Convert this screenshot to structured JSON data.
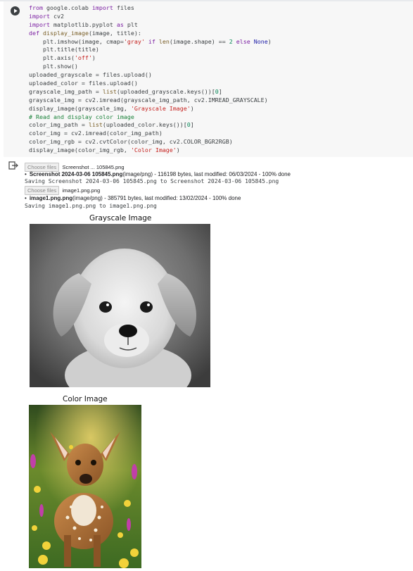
{
  "code_lines": [
    [
      {
        "t": "from",
        "c": "kw"
      },
      {
        "t": " google.colab "
      },
      {
        "t": "import",
        "c": "kw"
      },
      {
        "t": " files"
      }
    ],
    [
      {
        "t": "import",
        "c": "kw"
      },
      {
        "t": " cv2"
      }
    ],
    [
      {
        "t": "import",
        "c": "kw"
      },
      {
        "t": " matplotlib.pyplot "
      },
      {
        "t": "as",
        "c": "kw"
      },
      {
        "t": " plt"
      }
    ],
    [
      {
        "t": "def",
        "c": "kw"
      },
      {
        "t": " "
      },
      {
        "t": "display_image",
        "c": "bi"
      },
      {
        "t": "(image, title):"
      }
    ],
    [
      {
        "t": "    plt.imshow(image, cmap="
      },
      {
        "t": "'gray'",
        "c": "str"
      },
      {
        "t": " "
      },
      {
        "t": "if",
        "c": "kw"
      },
      {
        "t": " "
      },
      {
        "t": "len",
        "c": "bi"
      },
      {
        "t": "(image.shape) == "
      },
      {
        "t": "2",
        "c": "num"
      },
      {
        "t": " "
      },
      {
        "t": "else",
        "c": "kw"
      },
      {
        "t": " "
      },
      {
        "t": "None",
        "c": "fn"
      },
      {
        "t": ")"
      }
    ],
    [
      {
        "t": "    plt.title(title)"
      }
    ],
    [
      {
        "t": "    plt.axis("
      },
      {
        "t": "'off'",
        "c": "str"
      },
      {
        "t": ")"
      }
    ],
    [
      {
        "t": "    plt.show()"
      }
    ],
    [
      {
        "t": "uploaded_grayscale = files.upload()"
      }
    ],
    [
      {
        "t": "uploaded_color = files.upload()"
      }
    ],
    [
      {
        "t": "grayscale_img_path = "
      },
      {
        "t": "list",
        "c": "bi"
      },
      {
        "t": "(uploaded_grayscale.keys())["
      },
      {
        "t": "0",
        "c": "num"
      },
      {
        "t": "]"
      }
    ],
    [
      {
        "t": "grayscale_img = cv2.imread(grayscale_img_path, cv2.IMREAD_GRAYSCALE)"
      }
    ],
    [
      {
        "t": "display_image(grayscale_img, "
      },
      {
        "t": "'Grayscale Image'",
        "c": "str"
      },
      {
        "t": ")"
      }
    ],
    [
      {
        "t": "# Read and display color image",
        "c": "cmt"
      }
    ],
    [
      {
        "t": "color_img_path = "
      },
      {
        "t": "list",
        "c": "bi"
      },
      {
        "t": "(uploaded_color.keys())["
      },
      {
        "t": "0",
        "c": "num"
      },
      {
        "t": "]"
      }
    ],
    [
      {
        "t": "color_img = cv2.imread(color_img_path)"
      }
    ],
    [
      {
        "t": "color_img_rgb = cv2.cvtColor(color_img, cv2.COLOR_BGR2RGB)"
      }
    ],
    [
      {
        "t": "display_image(color_img_rgb, "
      },
      {
        "t": "'Color Image'",
        "c": "str"
      },
      {
        "t": ")"
      }
    ]
  ],
  "output": {
    "upload1": {
      "choose_label": "Choose files",
      "file_display": "Screenshot ... 105845.png",
      "bullet_name": "Screenshot 2024-03-06 105845.png",
      "bullet_rest": "(image/png) - 116198 bytes, last modified: 06/03/2024 - 100% done",
      "saving": "Saving Screenshot 2024-03-06 105845.png to Screenshot 2024-03-06 105845.png"
    },
    "upload2": {
      "choose_label": "Choose files",
      "file_display": "image1.png.png",
      "bullet_name": "image1.png.png",
      "bullet_rest": "(image/png) - 385791 bytes, last modified: 13/02/2024 - 100% done",
      "saving": "Saving image1.png.png to image1.png.png"
    },
    "figure1_title": "Grayscale Image",
    "figure2_title": "Color Image"
  }
}
